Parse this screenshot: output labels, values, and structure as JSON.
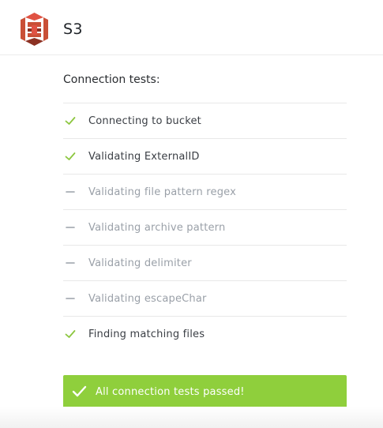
{
  "header": {
    "title": "S3",
    "logo_icon": "aws-s3-logo-icon",
    "logo_colors": [
      "#c94f36",
      "#8c3123",
      "#e05243"
    ]
  },
  "section": {
    "title": "Connection tests:"
  },
  "tests": [
    {
      "label": "Connecting to bucket",
      "status": "passed",
      "icon": "check-icon"
    },
    {
      "label": "Validating ExternalID",
      "status": "passed",
      "icon": "check-icon"
    },
    {
      "label": "Validating file pattern regex",
      "status": "skipped",
      "icon": "dash-icon"
    },
    {
      "label": "Validating archive pattern",
      "status": "skipped",
      "icon": "dash-icon"
    },
    {
      "label": "Validating delimiter",
      "status": "skipped",
      "icon": "dash-icon"
    },
    {
      "label": "Validating escapeChar",
      "status": "skipped",
      "icon": "dash-icon"
    },
    {
      "label": "Finding matching files",
      "status": "passed",
      "icon": "check-icon"
    }
  ],
  "banner": {
    "text": "All connection tests passed!",
    "icon": "check-icon",
    "color": "#8fcf3c"
  },
  "colors": {
    "pass": "#8cc63f",
    "skip": "#9aa0a8"
  }
}
